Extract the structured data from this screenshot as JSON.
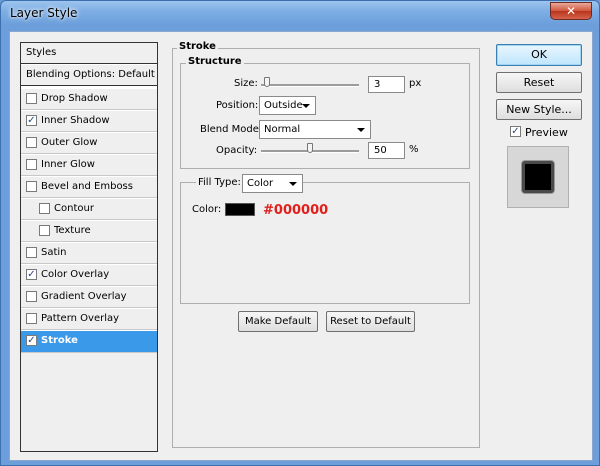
{
  "window": {
    "title": "Layer Style",
    "close_glyph": "✕"
  },
  "styles_panel": {
    "header": "Styles",
    "blending": "Blending Options: Default",
    "items": [
      {
        "label": "Drop Shadow",
        "checked": false
      },
      {
        "label": "Inner Shadow",
        "checked": true
      },
      {
        "label": "Outer Glow",
        "checked": false
      },
      {
        "label": "Inner Glow",
        "checked": false
      },
      {
        "label": "Bevel and Emboss",
        "checked": false
      },
      {
        "label": "Contour",
        "checked": false,
        "indent": true
      },
      {
        "label": "Texture",
        "checked": false,
        "indent": true
      },
      {
        "label": "Satin",
        "checked": false
      },
      {
        "label": "Color Overlay",
        "checked": true
      },
      {
        "label": "Gradient Overlay",
        "checked": false
      },
      {
        "label": "Pattern Overlay",
        "checked": false
      },
      {
        "label": "Stroke",
        "checked": true,
        "selected": true
      }
    ],
    "check_glyph": "✓"
  },
  "stroke": {
    "group_title": "Stroke",
    "structure_title": "Structure",
    "size": {
      "label": "Size:",
      "value": "3",
      "unit": "px",
      "slider_level": 0.03
    },
    "position": {
      "label": "Position:",
      "value": "Outside"
    },
    "blend_mode": {
      "label": "Blend Mode:",
      "value": "Normal"
    },
    "opacity": {
      "label": "Opacity:",
      "value": "50",
      "unit": "%",
      "slider_level": 0.5
    },
    "fill_type": {
      "label": "Fill Type:",
      "value": "Color"
    },
    "color": {
      "label": "Color:",
      "swatch": "#000000",
      "hex_note": "#000000"
    },
    "make_default": "Make Default",
    "reset_default": "Reset to Default"
  },
  "right_panel": {
    "ok": "OK",
    "reset": "Reset",
    "new_style": "New Style...",
    "preview_label": "Preview",
    "preview_checked": true
  },
  "colors": {
    "selection": "#3a99e8",
    "hex_note": "#e0201c"
  }
}
